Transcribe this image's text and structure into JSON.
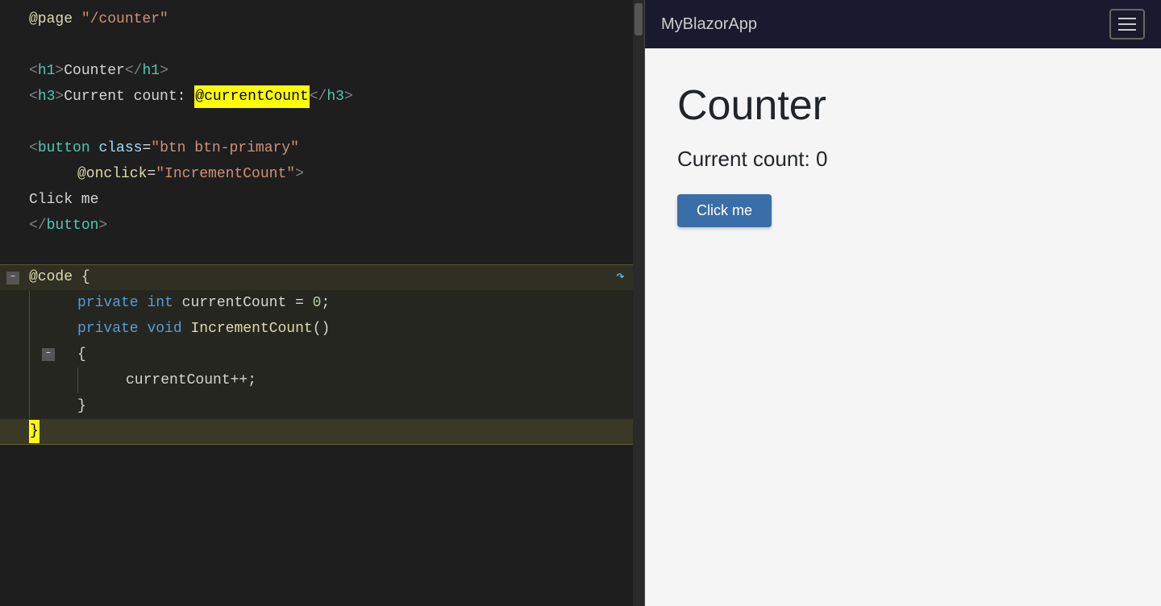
{
  "editor": {
    "lines": [
      {
        "id": 1,
        "indent": 0,
        "content": [
          {
            "t": "@page \"/counter\"",
            "c": "mixed"
          }
        ],
        "hasCollapse": false,
        "highlighted": false
      },
      {
        "id": 2,
        "indent": 0,
        "content": [],
        "hasCollapse": false,
        "highlighted": false
      },
      {
        "id": 3,
        "indent": 0,
        "content": [
          {
            "t": "<h1>Counter</h1>",
            "c": "html"
          }
        ],
        "hasCollapse": false,
        "highlighted": false
      },
      {
        "id": 4,
        "indent": 0,
        "content": [
          {
            "t": "<h3>Current count: @currentCount</h3>",
            "c": "html2"
          }
        ],
        "hasCollapse": false,
        "highlighted": false
      },
      {
        "id": 5,
        "indent": 0,
        "content": [],
        "hasCollapse": false,
        "highlighted": false
      },
      {
        "id": 6,
        "indent": 0,
        "content": [
          {
            "t": "<button class=\"btn btn-primary\"",
            "c": "html3"
          }
        ],
        "hasCollapse": false,
        "highlighted": false
      },
      {
        "id": 7,
        "indent": 1,
        "content": [
          {
            "t": "@onclick=\"IncrementCount\">",
            "c": "html4"
          }
        ],
        "hasCollapse": false,
        "highlighted": false
      },
      {
        "id": 8,
        "indent": 0,
        "content": [
          {
            "t": "Click me",
            "c": "plain"
          }
        ],
        "hasCollapse": false,
        "highlighted": false
      },
      {
        "id": 9,
        "indent": 0,
        "content": [
          {
            "t": "</button>",
            "c": "tag"
          }
        ],
        "hasCollapse": false,
        "highlighted": false
      },
      {
        "id": 10,
        "indent": 0,
        "content": [],
        "hasCollapse": false,
        "highlighted": false
      },
      {
        "id": 11,
        "indent": 0,
        "content": [
          {
            "t": "@code {",
            "c": "atcode"
          }
        ],
        "hasCollapse": true,
        "highlighted": true
      },
      {
        "id": 12,
        "indent": 1,
        "content": [
          {
            "t": "private int currentCount = 0;",
            "c": "csharp"
          }
        ],
        "hasCollapse": false,
        "highlighted": false,
        "inBlock": true
      },
      {
        "id": 13,
        "indent": 1,
        "content": [
          {
            "t": "private void IncrementCount()",
            "c": "csharp2"
          }
        ],
        "hasCollapse": false,
        "highlighted": false,
        "inBlock": true
      },
      {
        "id": 14,
        "indent": 1,
        "content": [
          {
            "t": "{",
            "c": "plain"
          }
        ],
        "hasCollapse": true,
        "highlighted": false,
        "inBlock": true
      },
      {
        "id": 15,
        "indent": 2,
        "content": [
          {
            "t": "currentCount++;",
            "c": "plain"
          }
        ],
        "hasCollapse": false,
        "highlighted": false,
        "inBlock": true
      },
      {
        "id": 16,
        "indent": 1,
        "content": [
          {
            "t": "}",
            "c": "plain"
          }
        ],
        "hasCollapse": false,
        "highlighted": false,
        "inBlock": true
      },
      {
        "id": 17,
        "indent": 0,
        "content": [
          {
            "t": "}",
            "c": "yellow"
          }
        ],
        "hasCollapse": false,
        "highlighted": true
      }
    ]
  },
  "preview": {
    "navbar_brand": "MyBlazorApp",
    "page_title": "Counter",
    "current_count_label": "Current count: 0",
    "button_label": "Click me"
  }
}
